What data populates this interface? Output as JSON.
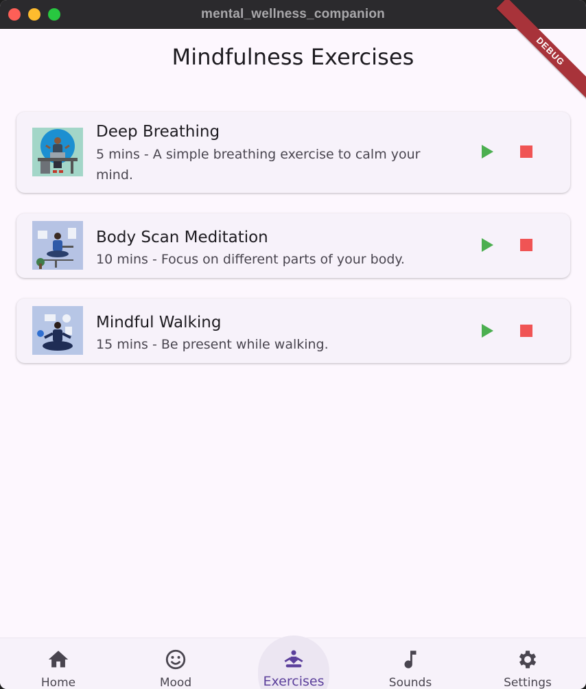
{
  "window": {
    "title": "mental_wellness_companion"
  },
  "debug_banner": "DEBUG",
  "page": {
    "title": "Mindfulness Exercises"
  },
  "exercises": [
    {
      "title": "Deep Breathing",
      "description": "5 mins - A simple breathing exercise to calm your mind.",
      "image": "man-at-desk-meditating-illustration"
    },
    {
      "title": "Body Scan Meditation",
      "description": "10 mins - Focus on different parts of your body.",
      "image": "woman-meditating-in-office-illustration"
    },
    {
      "title": "Mindful Walking",
      "description": "15 mins - Be present while walking.",
      "image": "man-meditating-with-devices-illustration"
    }
  ],
  "colors": {
    "play": "#4caf50",
    "stop": "#f05454",
    "accent": "#5b3f9b",
    "background": "#fdf7fe",
    "card": "#f7f2fa"
  },
  "nav": {
    "items": [
      {
        "label": "Home",
        "icon": "home-icon"
      },
      {
        "label": "Mood",
        "icon": "smiley-icon"
      },
      {
        "label": "Exercises",
        "icon": "meditation-icon",
        "selected": true
      },
      {
        "label": "Sounds",
        "icon": "music-note-icon"
      },
      {
        "label": "Settings",
        "icon": "gear-icon"
      }
    ]
  }
}
